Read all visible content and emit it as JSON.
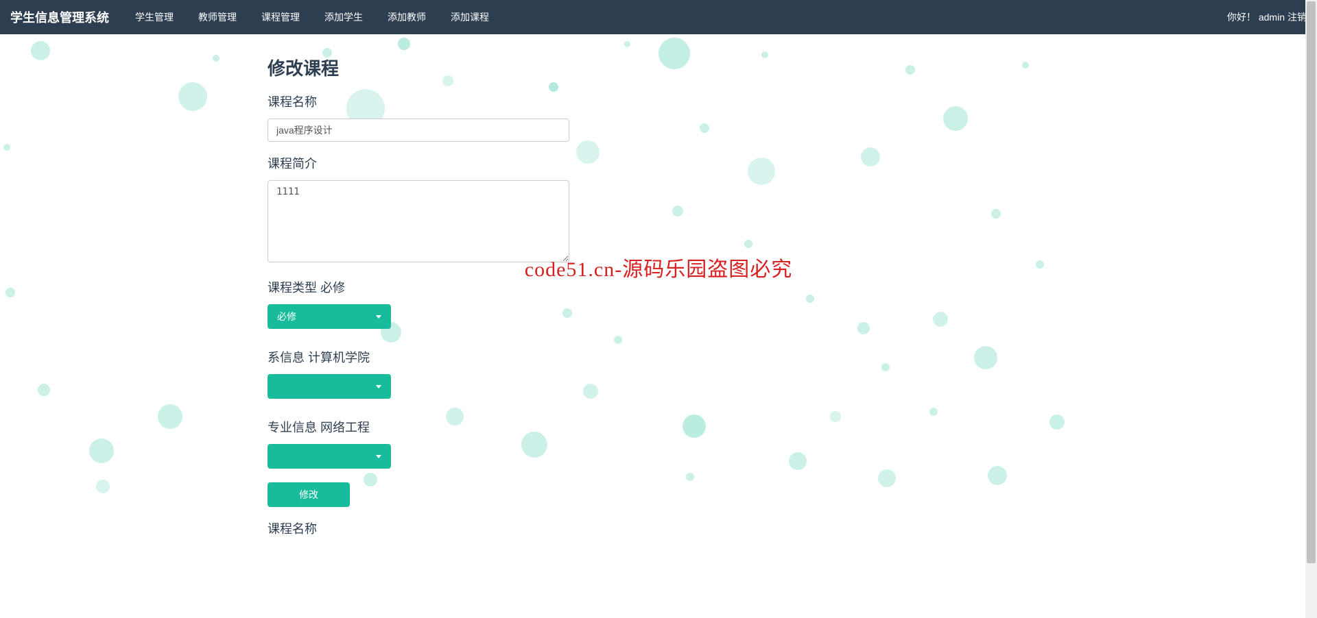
{
  "navbar": {
    "brand": "学生信息管理系统",
    "items": [
      "学生管理",
      "教师管理",
      "课程管理",
      "添加学生",
      "添加教师",
      "添加课程"
    ],
    "greeting": "你好！",
    "username": "admin",
    "logout": "注销"
  },
  "form": {
    "title": "修改课程",
    "course_name_label": "课程名称",
    "course_name_value": "java程序设计",
    "course_desc_label": "课程简介",
    "course_desc_value": "1111",
    "course_type_label": "课程类型 必修",
    "course_type_selected": "必修",
    "dept_label": "系信息 计算机学院",
    "dept_selected": "",
    "major_label": "专业信息 网络工程",
    "major_selected": "",
    "submit_label": "修改",
    "course_name_label2": "课程名称"
  },
  "watermark": "code51.cn-源码乐园盗图必究"
}
